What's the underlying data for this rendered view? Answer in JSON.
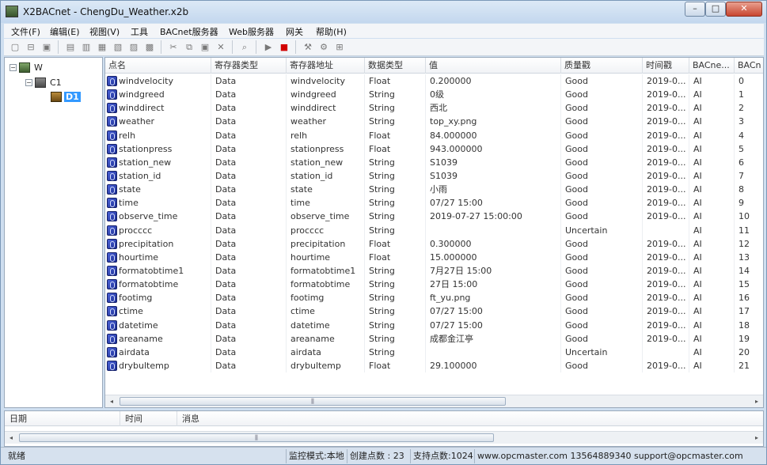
{
  "window": {
    "title": "X2BACnet - ChengDu_Weather.x2b",
    "buttons": {
      "minimize": "–",
      "maximize": "□",
      "close": "✕"
    }
  },
  "menu": [
    "文件(F)",
    "编辑(E)",
    "视图(V)",
    "工具",
    "BACnet服务器",
    "Web服务器",
    "网关",
    "帮助(H)"
  ],
  "tree": {
    "root": "W",
    "child": "C1",
    "device": "D1"
  },
  "grid": {
    "columns": [
      "点名",
      "寄存器类型",
      "寄存器地址",
      "数据类型",
      "值",
      "质量戳",
      "时间戳",
      "BACne...",
      "BACn"
    ],
    "rows": [
      [
        "windvelocity",
        "Data",
        "windvelocity",
        "Float",
        "0.200000",
        "Good",
        "2019-0...",
        "AI",
        "0"
      ],
      [
        "windgreed",
        "Data",
        "windgreed",
        "String",
        "0级",
        "Good",
        "2019-0...",
        "AI",
        "1"
      ],
      [
        "winddirect",
        "Data",
        "winddirect",
        "String",
        "西北",
        "Good",
        "2019-0...",
        "AI",
        "2"
      ],
      [
        "weather",
        "Data",
        "weather",
        "String",
        "top_xy.png",
        "Good",
        "2019-0...",
        "AI",
        "3"
      ],
      [
        "relh",
        "Data",
        "relh",
        "Float",
        "84.000000",
        "Good",
        "2019-0...",
        "AI",
        "4"
      ],
      [
        "stationpress",
        "Data",
        "stationpress",
        "Float",
        "943.000000",
        "Good",
        "2019-0...",
        "AI",
        "5"
      ],
      [
        "station_new",
        "Data",
        "station_new",
        "String",
        "S1039",
        "Good",
        "2019-0...",
        "AI",
        "6"
      ],
      [
        "station_id",
        "Data",
        "station_id",
        "String",
        "S1039",
        "Good",
        "2019-0...",
        "AI",
        "7"
      ],
      [
        "state",
        "Data",
        "state",
        "String",
        "小雨",
        "Good",
        "2019-0...",
        "AI",
        "8"
      ],
      [
        "time",
        "Data",
        "time",
        "String",
        "07/27 15:00",
        "Good",
        "2019-0...",
        "AI",
        "9"
      ],
      [
        "observe_time",
        "Data",
        "observe_time",
        "String",
        "2019-07-27 15:00:00",
        "Good",
        "2019-0...",
        "AI",
        "10"
      ],
      [
        "procccc",
        "Data",
        "procccc",
        "String",
        "",
        "Uncertain",
        "",
        "AI",
        "11"
      ],
      [
        "precipitation",
        "Data",
        "precipitation",
        "Float",
        "0.300000",
        "Good",
        "2019-0...",
        "AI",
        "12"
      ],
      [
        "hourtime",
        "Data",
        "hourtime",
        "Float",
        "15.000000",
        "Good",
        "2019-0...",
        "AI",
        "13"
      ],
      [
        "formatobtime1",
        "Data",
        "formatobtime1",
        "String",
        "7月27日 15:00",
        "Good",
        "2019-0...",
        "AI",
        "14"
      ],
      [
        "formatobtime",
        "Data",
        "formatobtime",
        "String",
        "27日 15:00",
        "Good",
        "2019-0...",
        "AI",
        "15"
      ],
      [
        "footimg",
        "Data",
        "footimg",
        "String",
        "ft_yu.png",
        "Good",
        "2019-0...",
        "AI",
        "16"
      ],
      [
        "ctime",
        "Data",
        "ctime",
        "String",
        "07/27 15:00",
        "Good",
        "2019-0...",
        "AI",
        "17"
      ],
      [
        "datetime",
        "Data",
        "datetime",
        "String",
        "07/27 15:00",
        "Good",
        "2019-0...",
        "AI",
        "18"
      ],
      [
        "areaname",
        "Data",
        "areaname",
        "String",
        "成都金江亭",
        "Good",
        "2019-0...",
        "AI",
        "19"
      ],
      [
        "airdata",
        "Data",
        "airdata",
        "String",
        "",
        "Uncertain",
        "",
        "AI",
        "20"
      ],
      [
        "drybultemp",
        "Data",
        "drybultemp",
        "Float",
        "29.100000",
        "Good",
        "2019-0...",
        "AI",
        "21"
      ]
    ]
  },
  "log": {
    "columns": [
      "日期",
      "时间",
      "消息"
    ]
  },
  "status": {
    "ready": "就绪",
    "mode": "监控模式:本地",
    "created_points": "创建点数 : 23",
    "supported_points": "支持点数:1024",
    "contact": "www.opcmaster.com 13564889340 support@opcmaster.com"
  }
}
